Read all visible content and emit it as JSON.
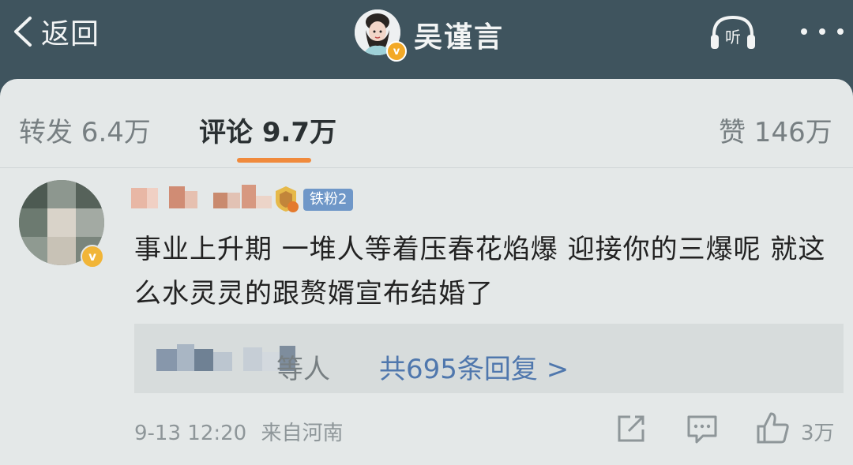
{
  "header": {
    "back_label": "返回",
    "title": "吴谨言",
    "verified_mark": "v",
    "listen_label": "听"
  },
  "tabs": [
    {
      "label": "转发 6.4万",
      "active": false
    },
    {
      "label": "评论 9.7万",
      "active": true
    },
    {
      "label": "赞 146万",
      "active": false
    }
  ],
  "comment": {
    "username_blurred": true,
    "fan_badge": "铁粉2",
    "verified_mark": "v",
    "text": "事业上升期 一堆人等着压春花焰爆 迎接你的三爆呢 就这么水灵灵的跟赘婿宣布结婚了",
    "replies_suffix": "等人",
    "replies_link": "共695条回复 >",
    "timestamp": "9-13 12:20",
    "location": "来自河南",
    "like_count": "3万"
  },
  "colors": {
    "header_bg": "#3f545e",
    "content_bg": "#e4e8e8",
    "accent": "#f08a3c",
    "link": "#4f77ad",
    "fan_badge": "#6f97c8"
  }
}
